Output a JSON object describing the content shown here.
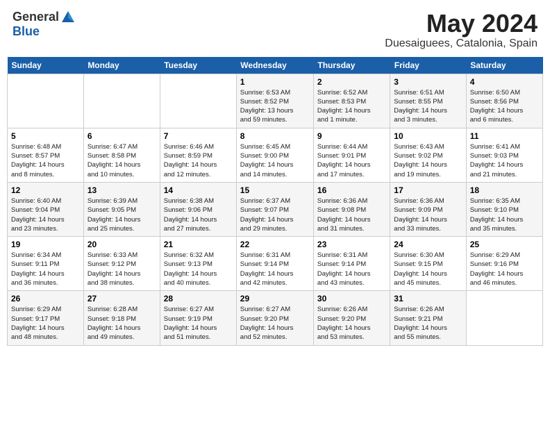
{
  "header": {
    "logo_general": "General",
    "logo_blue": "Blue",
    "month_title": "May 2024",
    "location": "Duesaiguees, Catalonia, Spain"
  },
  "weekdays": [
    "Sunday",
    "Monday",
    "Tuesday",
    "Wednesday",
    "Thursday",
    "Friday",
    "Saturday"
  ],
  "weeks": [
    [
      {
        "day": "",
        "info": ""
      },
      {
        "day": "",
        "info": ""
      },
      {
        "day": "",
        "info": ""
      },
      {
        "day": "1",
        "info": "Sunrise: 6:53 AM\nSunset: 8:52 PM\nDaylight: 13 hours\nand 59 minutes."
      },
      {
        "day": "2",
        "info": "Sunrise: 6:52 AM\nSunset: 8:53 PM\nDaylight: 14 hours\nand 1 minute."
      },
      {
        "day": "3",
        "info": "Sunrise: 6:51 AM\nSunset: 8:55 PM\nDaylight: 14 hours\nand 3 minutes."
      },
      {
        "day": "4",
        "info": "Sunrise: 6:50 AM\nSunset: 8:56 PM\nDaylight: 14 hours\nand 6 minutes."
      }
    ],
    [
      {
        "day": "5",
        "info": "Sunrise: 6:48 AM\nSunset: 8:57 PM\nDaylight: 14 hours\nand 8 minutes."
      },
      {
        "day": "6",
        "info": "Sunrise: 6:47 AM\nSunset: 8:58 PM\nDaylight: 14 hours\nand 10 minutes."
      },
      {
        "day": "7",
        "info": "Sunrise: 6:46 AM\nSunset: 8:59 PM\nDaylight: 14 hours\nand 12 minutes."
      },
      {
        "day": "8",
        "info": "Sunrise: 6:45 AM\nSunset: 9:00 PM\nDaylight: 14 hours\nand 14 minutes."
      },
      {
        "day": "9",
        "info": "Sunrise: 6:44 AM\nSunset: 9:01 PM\nDaylight: 14 hours\nand 17 minutes."
      },
      {
        "day": "10",
        "info": "Sunrise: 6:43 AM\nSunset: 9:02 PM\nDaylight: 14 hours\nand 19 minutes."
      },
      {
        "day": "11",
        "info": "Sunrise: 6:41 AM\nSunset: 9:03 PM\nDaylight: 14 hours\nand 21 minutes."
      }
    ],
    [
      {
        "day": "12",
        "info": "Sunrise: 6:40 AM\nSunset: 9:04 PM\nDaylight: 14 hours\nand 23 minutes."
      },
      {
        "day": "13",
        "info": "Sunrise: 6:39 AM\nSunset: 9:05 PM\nDaylight: 14 hours\nand 25 minutes."
      },
      {
        "day": "14",
        "info": "Sunrise: 6:38 AM\nSunset: 9:06 PM\nDaylight: 14 hours\nand 27 minutes."
      },
      {
        "day": "15",
        "info": "Sunrise: 6:37 AM\nSunset: 9:07 PM\nDaylight: 14 hours\nand 29 minutes."
      },
      {
        "day": "16",
        "info": "Sunrise: 6:36 AM\nSunset: 9:08 PM\nDaylight: 14 hours\nand 31 minutes."
      },
      {
        "day": "17",
        "info": "Sunrise: 6:36 AM\nSunset: 9:09 PM\nDaylight: 14 hours\nand 33 minutes."
      },
      {
        "day": "18",
        "info": "Sunrise: 6:35 AM\nSunset: 9:10 PM\nDaylight: 14 hours\nand 35 minutes."
      }
    ],
    [
      {
        "day": "19",
        "info": "Sunrise: 6:34 AM\nSunset: 9:11 PM\nDaylight: 14 hours\nand 36 minutes."
      },
      {
        "day": "20",
        "info": "Sunrise: 6:33 AM\nSunset: 9:12 PM\nDaylight: 14 hours\nand 38 minutes."
      },
      {
        "day": "21",
        "info": "Sunrise: 6:32 AM\nSunset: 9:13 PM\nDaylight: 14 hours\nand 40 minutes."
      },
      {
        "day": "22",
        "info": "Sunrise: 6:31 AM\nSunset: 9:14 PM\nDaylight: 14 hours\nand 42 minutes."
      },
      {
        "day": "23",
        "info": "Sunrise: 6:31 AM\nSunset: 9:14 PM\nDaylight: 14 hours\nand 43 minutes."
      },
      {
        "day": "24",
        "info": "Sunrise: 6:30 AM\nSunset: 9:15 PM\nDaylight: 14 hours\nand 45 minutes."
      },
      {
        "day": "25",
        "info": "Sunrise: 6:29 AM\nSunset: 9:16 PM\nDaylight: 14 hours\nand 46 minutes."
      }
    ],
    [
      {
        "day": "26",
        "info": "Sunrise: 6:29 AM\nSunset: 9:17 PM\nDaylight: 14 hours\nand 48 minutes."
      },
      {
        "day": "27",
        "info": "Sunrise: 6:28 AM\nSunset: 9:18 PM\nDaylight: 14 hours\nand 49 minutes."
      },
      {
        "day": "28",
        "info": "Sunrise: 6:27 AM\nSunset: 9:19 PM\nDaylight: 14 hours\nand 51 minutes."
      },
      {
        "day": "29",
        "info": "Sunrise: 6:27 AM\nSunset: 9:20 PM\nDaylight: 14 hours\nand 52 minutes."
      },
      {
        "day": "30",
        "info": "Sunrise: 6:26 AM\nSunset: 9:20 PM\nDaylight: 14 hours\nand 53 minutes."
      },
      {
        "day": "31",
        "info": "Sunrise: 6:26 AM\nSunset: 9:21 PM\nDaylight: 14 hours\nand 55 minutes."
      },
      {
        "day": "",
        "info": ""
      }
    ]
  ]
}
